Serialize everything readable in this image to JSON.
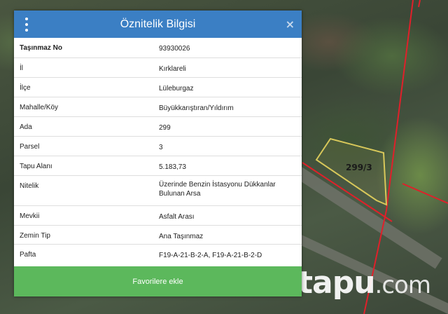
{
  "panel": {
    "title": "Öznitelik Bilgisi",
    "close_label": "×",
    "rows": [
      {
        "key": "Taşınmaz No",
        "value": "93930026"
      },
      {
        "key": "İl",
        "value": "Kırklareli"
      },
      {
        "key": "İlçe",
        "value": "Lüleburgaz"
      },
      {
        "key": "Mahalle/Köy",
        "value": "Büyükkarıştıran/Yıldırım"
      },
      {
        "key": "Ada",
        "value": "299"
      },
      {
        "key": "Parsel",
        "value": "3"
      },
      {
        "key": "Tapu Alanı",
        "value": "5.183,73"
      },
      {
        "key": "Nitelik",
        "value": "Üzerinde Benzin İstasyonu Dükkanlar Bulunan Arsa"
      },
      {
        "key": "Mevkii",
        "value": "Asfalt Arası"
      },
      {
        "key": "Zemin Tip",
        "value": "Ana Taşınmaz"
      },
      {
        "key": "Pafta",
        "value": "F19-A-21-B-2-A, F19-A-21-B-2-D"
      }
    ],
    "favorite_button": "Favorilere ekle"
  },
  "map": {
    "parcel_label": "299/3",
    "watermark_main": "tapu",
    "watermark_suffix": ".com"
  },
  "colors": {
    "header": "#3b7fc4",
    "favorite": "#5cb85c",
    "boundary": "#e0202a",
    "parcel": "#d8c85a"
  },
  "icons": {
    "menu": "kebab-menu-icon",
    "close": "close-icon"
  }
}
